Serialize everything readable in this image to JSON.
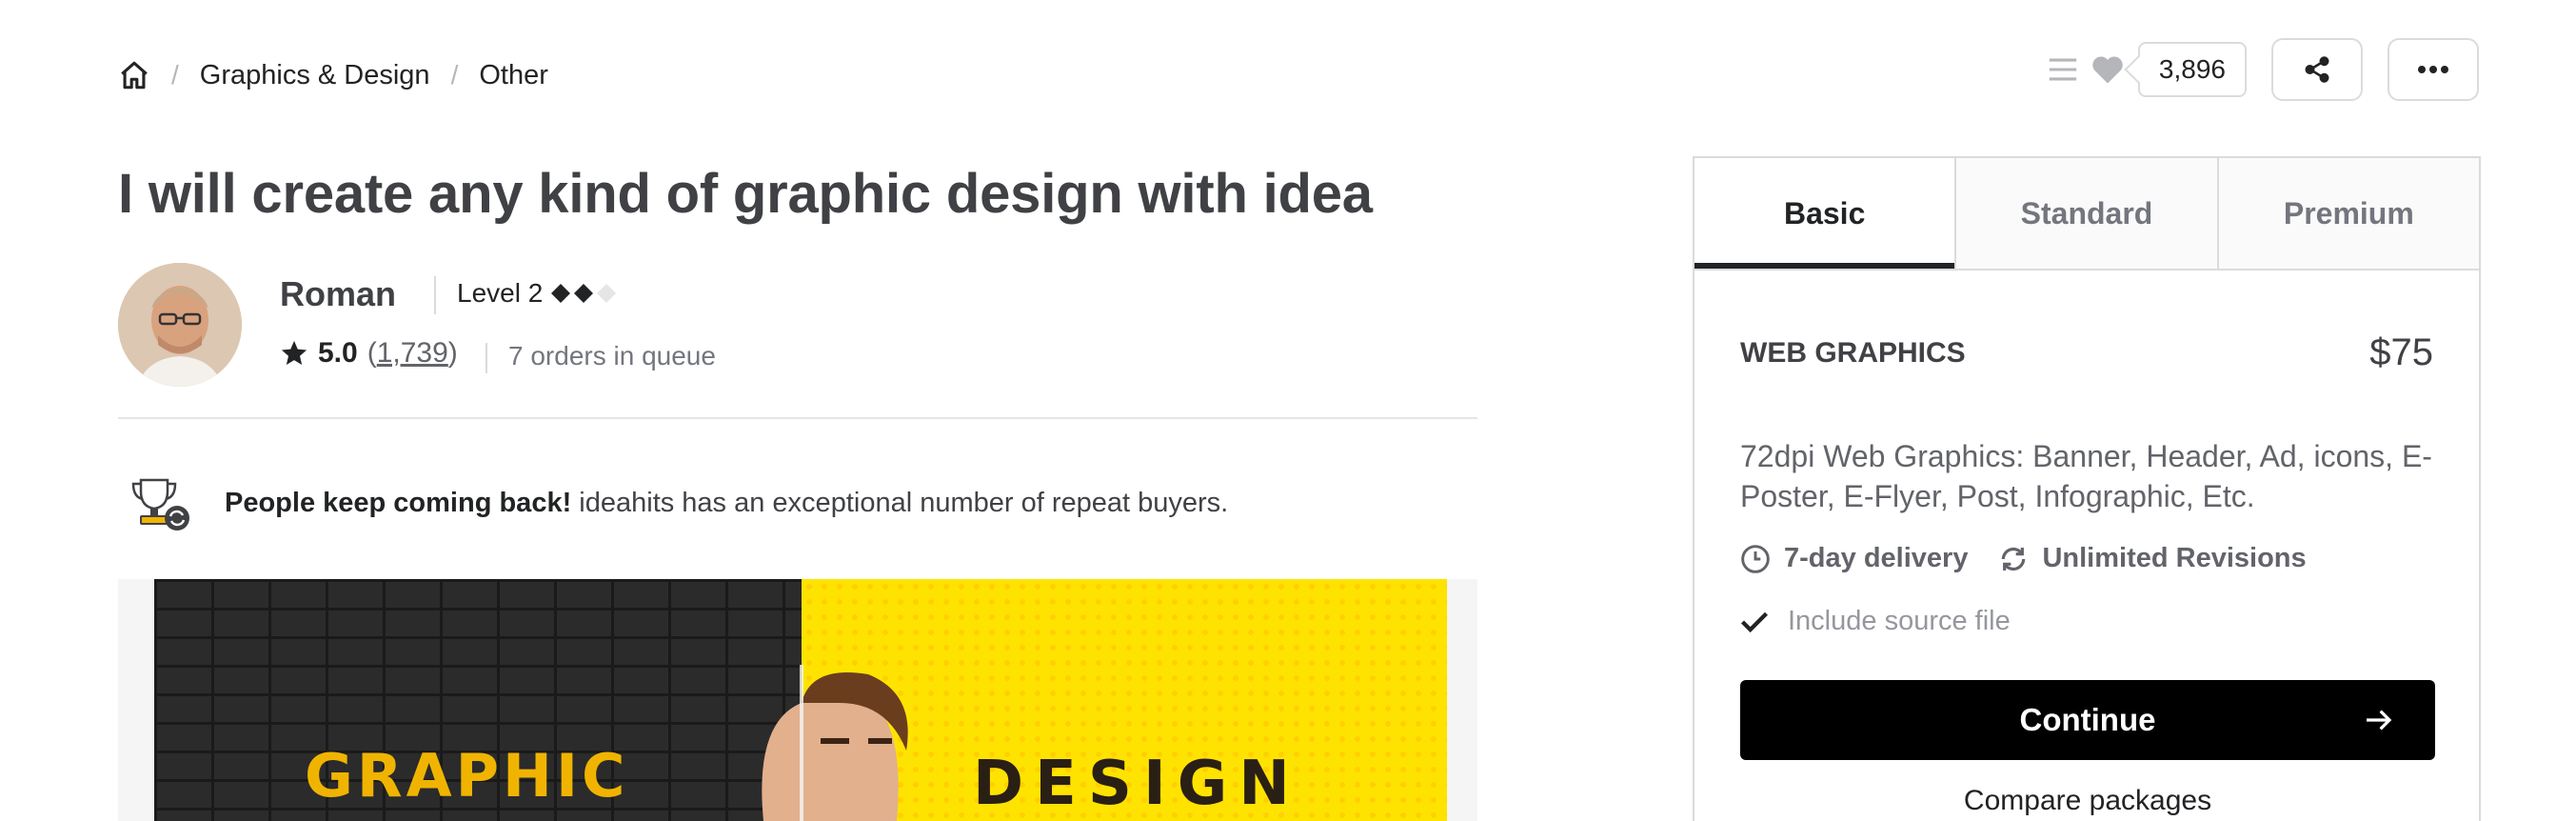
{
  "breadcrumb": {
    "items": [
      "Graphics & Design",
      "Other"
    ]
  },
  "actions": {
    "like_count": "3,896"
  },
  "gig": {
    "title": "I will create any kind of graphic design with idea"
  },
  "seller": {
    "name": "Roman",
    "level": "Level 2",
    "rating": "5.0",
    "reviews_open": "(",
    "reviews_count": "1,739",
    "reviews_close": ")",
    "queue": "7 orders in queue"
  },
  "highlight": {
    "bold": "People keep coming back!",
    "text": " ideahits has an exceptional number of repeat buyers."
  },
  "gallery": {
    "left_word": "GRAPHIC",
    "right_word": "DESIGN"
  },
  "package": {
    "tabs": [
      "Basic",
      "Standard",
      "Premium"
    ],
    "active_tab": "Basic",
    "name": "WEB GRAPHICS",
    "price": "$75",
    "description": "72dpi Web Graphics: Banner, Header, Ad, icons, E-Poster, E-Flyer, Post, Infographic, Etc.",
    "delivery": "7-day delivery",
    "revisions": "Unlimited Revisions",
    "feature": "Include source file",
    "continue_label": "Continue",
    "compare_label": "Compare packages"
  },
  "colors": {
    "text": "#404145",
    "border": "#dadbdd",
    "button_bg": "#000000",
    "gallery_yellow": "#ffe300",
    "gallery_gold": "#f0b400"
  }
}
